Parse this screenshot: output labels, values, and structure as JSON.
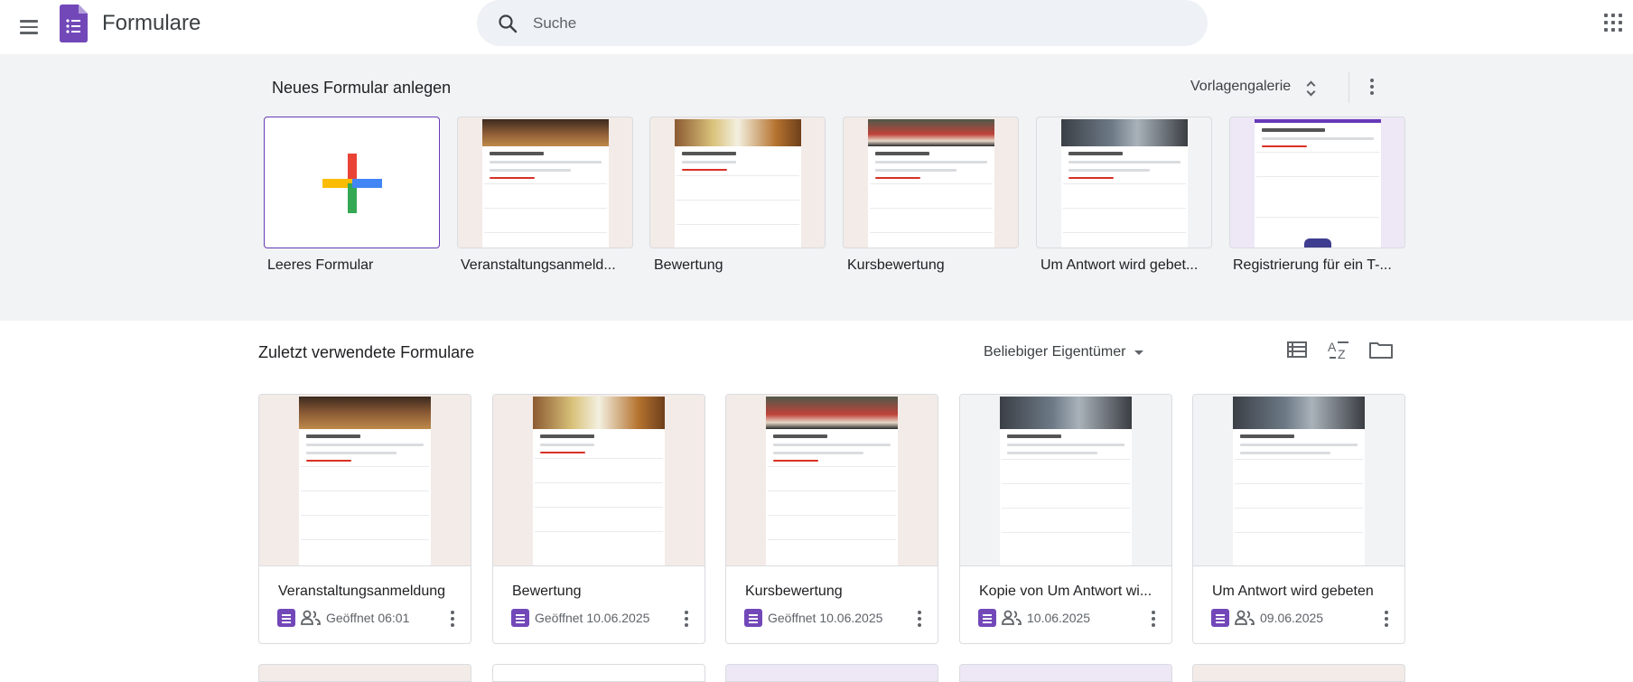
{
  "header": {
    "app_title": "Formulare",
    "search_placeholder": "Suche"
  },
  "templates": {
    "section_title": "Neues Formular anlegen",
    "gallery_label": "Vorlagengalerie",
    "items": [
      {
        "label": "Leeres Formular"
      },
      {
        "label": "Veranstaltungsanmeld..."
      },
      {
        "label": "Bewertung"
      },
      {
        "label": "Kursbewertung"
      },
      {
        "label": "Um Antwort wird gebet..."
      },
      {
        "label": "Registrierung für ein T-..."
      }
    ]
  },
  "recent": {
    "section_title": "Zuletzt verwendete Formulare",
    "owner_filter": "Beliebiger Eigentümer",
    "cards": [
      {
        "title": "Veranstaltungsanmeldung",
        "meta": "Geöffnet 06:01",
        "shared": true
      },
      {
        "title": "Bewertung",
        "meta": "Geöffnet 10.06.2025",
        "shared": false
      },
      {
        "title": "Kursbewertung",
        "meta": "Geöffnet 10.06.2025",
        "shared": false
      },
      {
        "title": "Kopie von Um Antwort wi...",
        "meta": "10.06.2025",
        "shared": true
      },
      {
        "title": "Um Antwort wird gebeten",
        "meta": "09.06.2025",
        "shared": true
      }
    ]
  },
  "colors": {
    "brand": "#7248b9",
    "band_bg": "#f1f3f4",
    "search_bg": "#eef1f6"
  }
}
